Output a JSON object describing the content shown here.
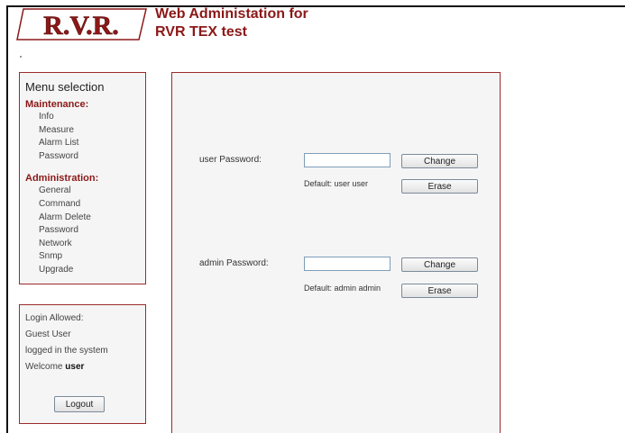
{
  "header": {
    "logo_text": "R.V.R.",
    "title_line1": "Web Administation for",
    "title_line2": "RVR TEX test"
  },
  "menu": {
    "title": "Menu selection",
    "sections": [
      {
        "label": "Maintenance:",
        "items": [
          "Info",
          "Measure",
          "Alarm List",
          "Password"
        ]
      },
      {
        "label": "Administration:",
        "items": [
          "General",
          "Command",
          "Alarm Delete",
          "Password",
          "Network",
          "Snmp",
          "Upgrade"
        ]
      }
    ]
  },
  "login": {
    "line1": "Login Allowed:",
    "line2": "Guest User",
    "line3": "logged in the system",
    "welcome_prefix": "Welcome",
    "username": "user",
    "logout_label": "Logout"
  },
  "passwords": [
    {
      "label": "user Password:",
      "value": "",
      "change_label": "Change",
      "default_text": "Default: user user",
      "erase_label": "Erase"
    },
    {
      "label": "admin Password:",
      "value": "",
      "change_label": "Change",
      "default_text": "Default: admin admin",
      "erase_label": "Erase"
    }
  ],
  "colors": {
    "accent": "#8b1818",
    "border": "#9c2a2a",
    "panel_bg": "#f5f5f5"
  }
}
